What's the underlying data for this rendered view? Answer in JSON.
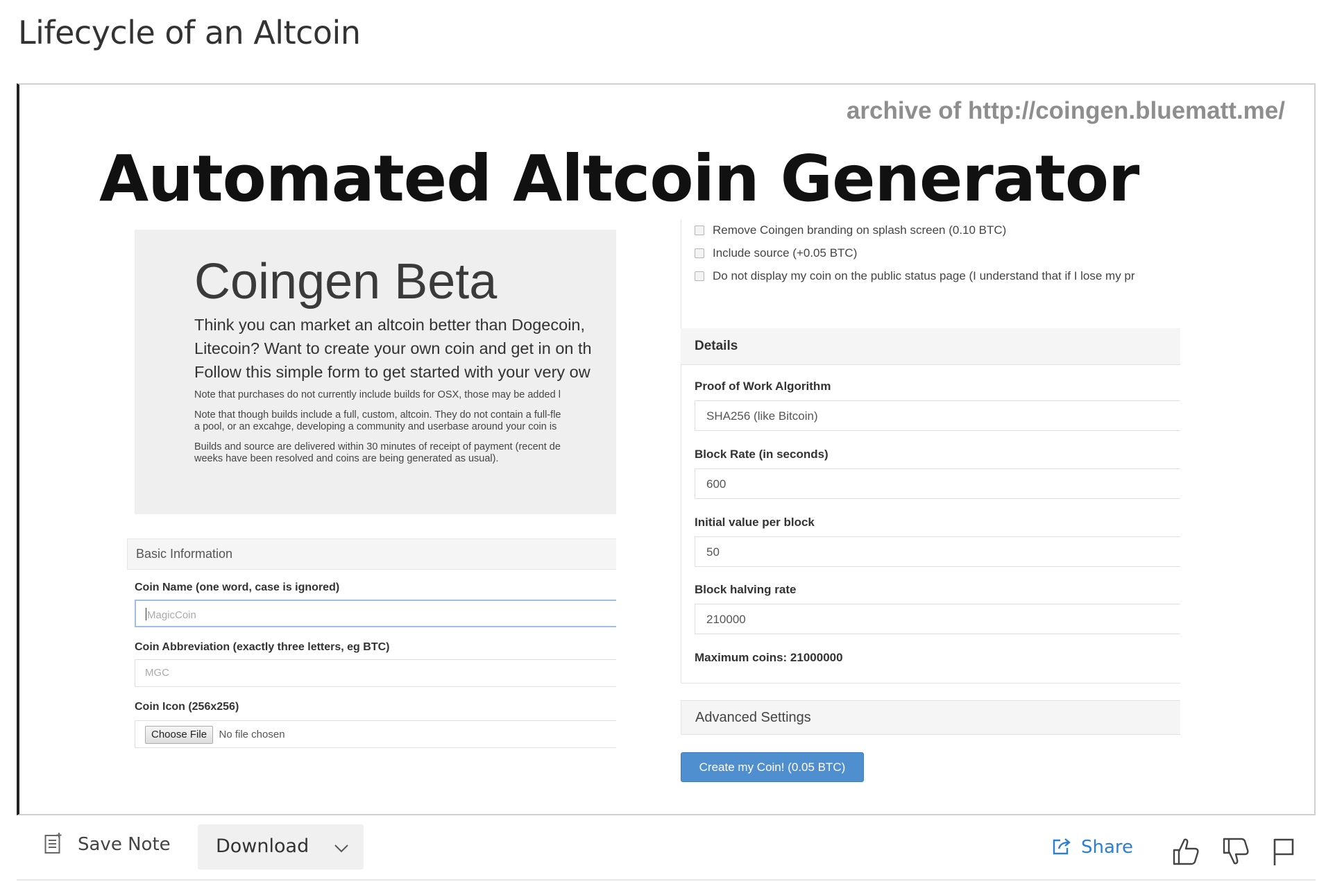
{
  "page": {
    "title": "Lifecycle of an Altcoin"
  },
  "slide": {
    "archive_note": "archive of http://coingen.bluematt.me/",
    "title": "Automated Altcoin Generator"
  },
  "coingen": {
    "jumbotron": {
      "title": "Coingen Beta",
      "lead_lines": [
        "Think you can market an altcoin better than Dogecoin,",
        "Litecoin? Want to create your own coin and get in on th",
        "Follow this simple form to get started with your very ow"
      ],
      "notes": [
        [
          "Note that purchases do not currently include builds for OSX, those may be added l"
        ],
        [
          "Note that though builds include a full, custom, altcoin. They do not contain a full-fle",
          "a pool, or an excahge, developing a community and userbase around your coin is"
        ],
        [
          "Builds and source are delivered within 30 minutes of receipt of payment (recent de",
          "weeks have been resolved and coins are being generated as usual)."
        ]
      ]
    },
    "basic_info": {
      "heading": "Basic Information",
      "coin_name_label": "Coin Name (one word, case is ignored)",
      "coin_name_placeholder": "MagicCoin",
      "abbrev_label": "Coin Abbreviation (exactly three letters, eg BTC)",
      "abbrev_placeholder": "MGC",
      "icon_label": "Coin Icon (256x256)",
      "choose_file": "Choose File",
      "no_file": "No file chosen"
    },
    "options": [
      "Remove Coingen branding on splash screen (0.10 BTC)",
      "Include source (+0.05 BTC)",
      "Do not display my coin on the public status page (I understand that if I lose my pr"
    ],
    "details": {
      "heading": "Details",
      "pow_label": "Proof of Work Algorithm",
      "pow_value": "SHA256 (like Bitcoin)",
      "block_rate_label": "Block Rate (in seconds)",
      "block_rate_value": "600",
      "initial_value_label": "Initial value per block",
      "initial_value_value": "50",
      "halving_label": "Block halving rate",
      "halving_value": "210000",
      "max_coins": "Maximum coins: 21000000"
    },
    "advanced_heading": "Advanced Settings",
    "create_button": "Create my Coin! (0.05 BTC)"
  },
  "toolbar": {
    "save_note": "Save Note",
    "download": "Download",
    "share": "Share",
    "icons": [
      "note-icon",
      "chevron-down-icon",
      "share-icon",
      "thumbs-up-icon",
      "thumbs-down-icon",
      "flag-icon"
    ],
    "accent_color": "#2d7fd6"
  }
}
